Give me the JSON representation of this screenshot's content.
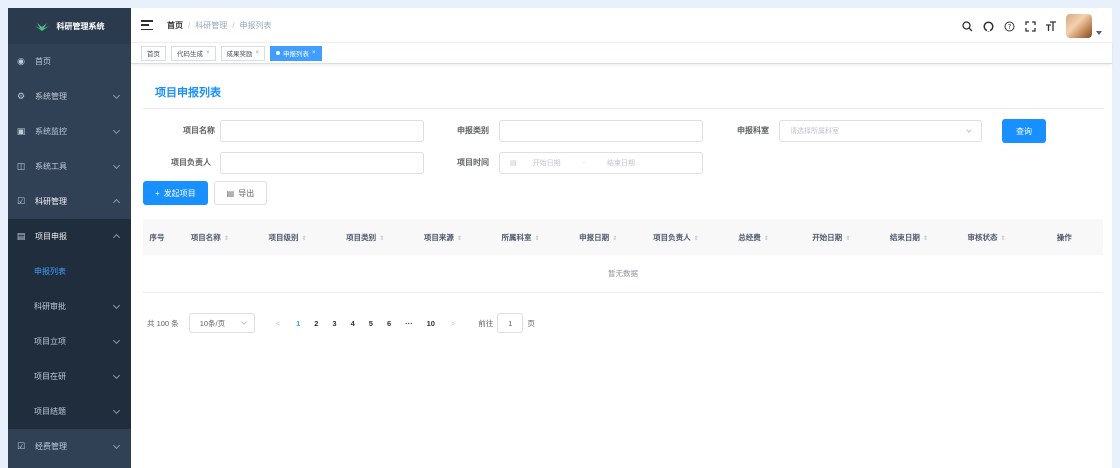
{
  "app": {
    "title": "科研管理系统"
  },
  "sidebar": {
    "items": [
      {
        "label": "首页",
        "icon": "dashboard-icon"
      },
      {
        "label": "系统管理",
        "icon": "gear-icon"
      },
      {
        "label": "系统监控",
        "icon": "monitor-icon"
      },
      {
        "label": "系统工具",
        "icon": "toolbox-icon"
      },
      {
        "label": "科研管理",
        "icon": "checkbox-icon"
      }
    ],
    "research_submenu": {
      "label": "项目申报",
      "icon": "doc-icon"
    },
    "declare_children": [
      "申报列表"
    ],
    "research_children": [
      "科研审批",
      "项目立项",
      "项目在研",
      "项目结题"
    ],
    "fund": {
      "label": "经费管理",
      "icon": "checkbox-icon"
    }
  },
  "breadcrumb": [
    "首页",
    "科研管理",
    "申报列表"
  ],
  "tags": [
    {
      "label": "首页",
      "closable": false,
      "active": false
    },
    {
      "label": "代码生成",
      "closable": true,
      "active": false
    },
    {
      "label": "成果奖励",
      "closable": true,
      "active": false
    },
    {
      "label": "申报列表",
      "closable": true,
      "active": true
    }
  ],
  "page": {
    "title": "项目申报列表"
  },
  "form": {
    "project_name_label": "项目名称",
    "declare_type_label": "申报类别",
    "declare_dept_label": "申报科室",
    "declare_dept_placeholder": "请选择所属科室",
    "leader_label": "项目负责人",
    "time_label": "项目时间",
    "start_placeholder": "开始日期",
    "range_sep": "-",
    "end_placeholder": "结束日期",
    "query_label": "查询"
  },
  "toolbar": {
    "add_label": "发起项目",
    "export_label": "导出"
  },
  "table": {
    "headers": [
      "序号",
      "项目名称",
      "项目级别",
      "项目类别",
      "项目来源",
      "所属科室",
      "申报日期",
      "项目负责人",
      "总经费",
      "开始日期",
      "结束日期",
      "审核状态",
      "操作"
    ],
    "empty_text": "暂无数据"
  },
  "pagination": {
    "total_text": "共 100 条",
    "page_size": "10条/页",
    "pages": [
      "1",
      "2",
      "3",
      "4",
      "5",
      "6",
      "···",
      "10"
    ],
    "current": "1",
    "goto_prefix": "前往",
    "goto_value": "1",
    "goto_suffix": "页"
  },
  "colors": {
    "sidebar_bg": "#304156",
    "primary": "#1890ff",
    "active_link": "#409eff"
  }
}
